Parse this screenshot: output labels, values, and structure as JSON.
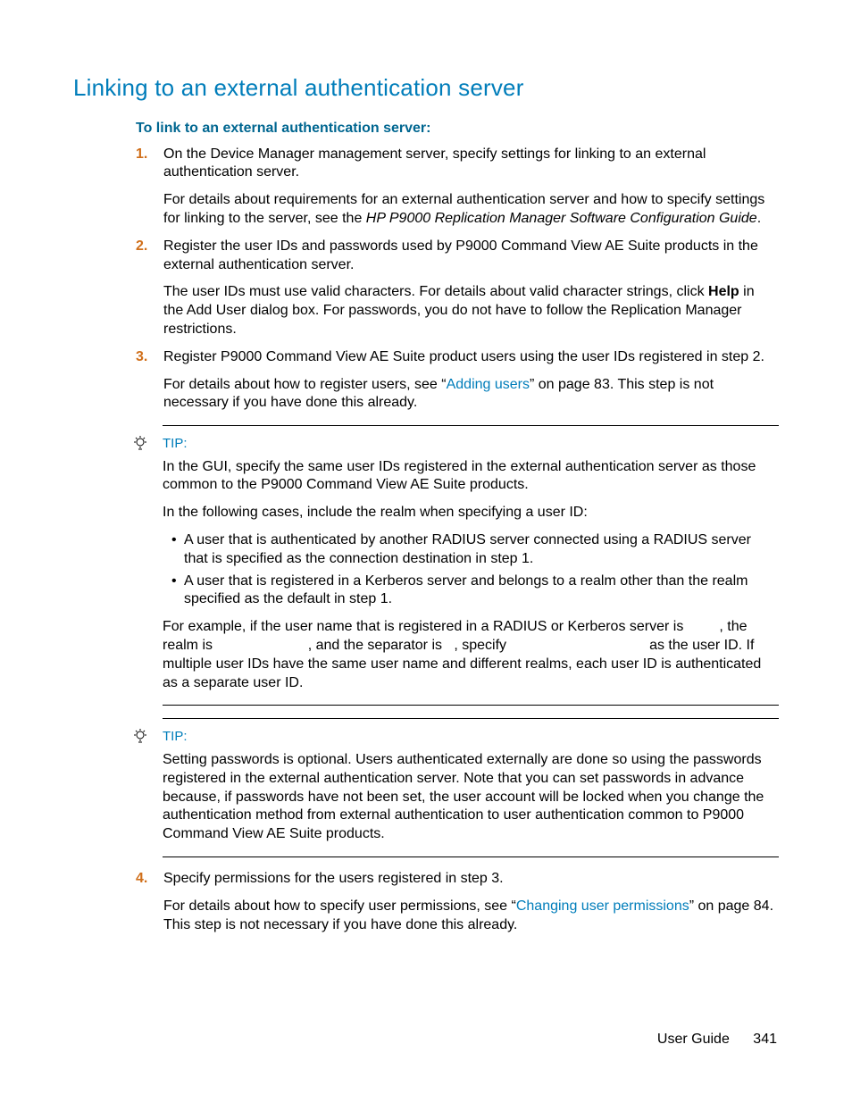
{
  "title": "Linking to an external authentication server",
  "subheading": "To link to an external authentication server:",
  "steps": {
    "s1": {
      "num": "1.",
      "p1": "On the Device Manager management server, specify settings for linking to an external authentication server.",
      "p2a": "For details about requirements for an external authentication server and how to specify settings for linking to the server, see the ",
      "p2b": "HP P9000 Replication Manager Software Configuration Guide",
      "p2c": "."
    },
    "s2": {
      "num": "2.",
      "p1": "Register the user IDs and passwords used by P9000 Command View AE Suite products in the external authentication server.",
      "p2a": "The user IDs must use valid characters. For details about valid character strings, click ",
      "p2b": "Help",
      "p2c": " in the Add User dialog box. For passwords, you do not have to follow the Replication Manager restrictions."
    },
    "s3": {
      "num": "3.",
      "p1": "Register P9000 Command View AE Suite product users using the user IDs registered in step 2.",
      "p2a": "For details about how to register users, see “",
      "p2b": "Adding users",
      "p2c": "” on page 83. This step is not necessary if you have done this already."
    },
    "s4": {
      "num": "4.",
      "p1": "Specify permissions for the users registered in step 3.",
      "p2a": "For details about how to specify user permissions, see “",
      "p2b": "Changing user permissions",
      "p2c": "” on page 84. This step is not necessary if you have done this already."
    }
  },
  "tip1": {
    "label": "TIP:",
    "p1": "In the GUI, specify the same user IDs registered in the external authentication server as those common to the P9000 Command View AE Suite products.",
    "p2": "In the following cases, include the realm when specifying a user ID:",
    "b1": "A user that is authenticated by another RADIUS server connected using a RADIUS server that is specified as the connection destination in step 1.",
    "b2": "A user that is registered in a Kerberos server and belongs to a realm other than the realm specified as the default in step 1.",
    "p3": "For example, if the user name that is registered in a RADIUS or Kerberos server is         , the realm is                        , and the separator is   , specify                                    as the user ID. If multiple user IDs have the same user name and different realms, each user ID is authenticated as a separate user ID."
  },
  "tip2": {
    "label": "TIP:",
    "p1": "Setting passwords is optional. Users authenticated externally are done so using the passwords registered in the external authentication server. Note that you can set passwords in advance because, if passwords have not been set, the user account will be locked when you change the authentication method from external authentication to user authentication common to P9000 Command View AE Suite products."
  },
  "footer": {
    "label": "User Guide",
    "page": "341"
  }
}
